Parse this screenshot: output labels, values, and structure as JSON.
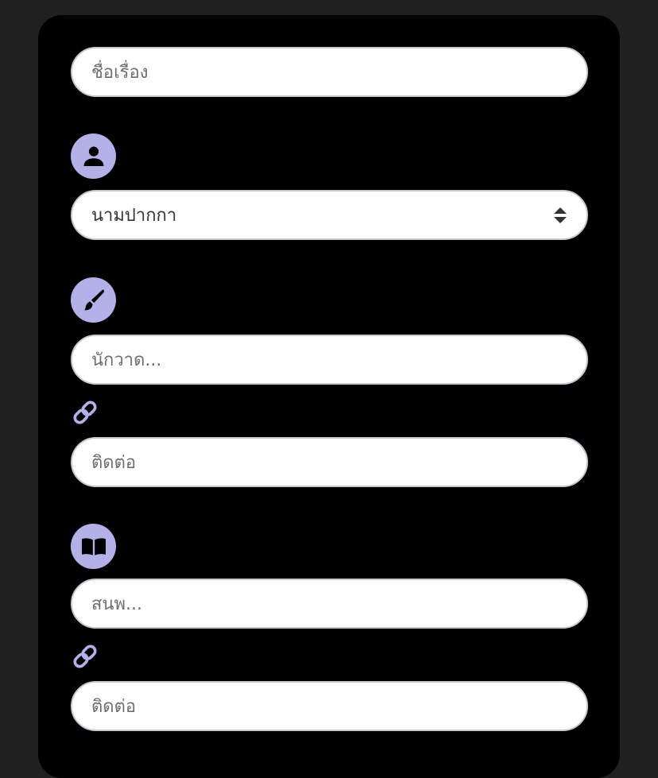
{
  "form": {
    "title_placeholder": "ชื่อเรื่อง",
    "penname_select_value": "นามปากกา",
    "illustrator_placeholder": "นักวาด...",
    "illustrator_contact_placeholder": "ติดต่อ",
    "publisher_placeholder": "สนพ...",
    "publisher_contact_placeholder": "ติดต่อ"
  },
  "icons": {
    "author": "user-icon",
    "illustrator": "paintbrush-icon",
    "illustrator_link": "link-icon",
    "publisher": "book-icon",
    "publisher_link": "link-icon",
    "select_arrow": "sort-icon"
  },
  "colors": {
    "page_background": "#202020",
    "panel_background": "#000000",
    "icon_accent": "#b4b0e8",
    "field_background": "#ffffff",
    "placeholder_text": "#6f6f6f"
  }
}
